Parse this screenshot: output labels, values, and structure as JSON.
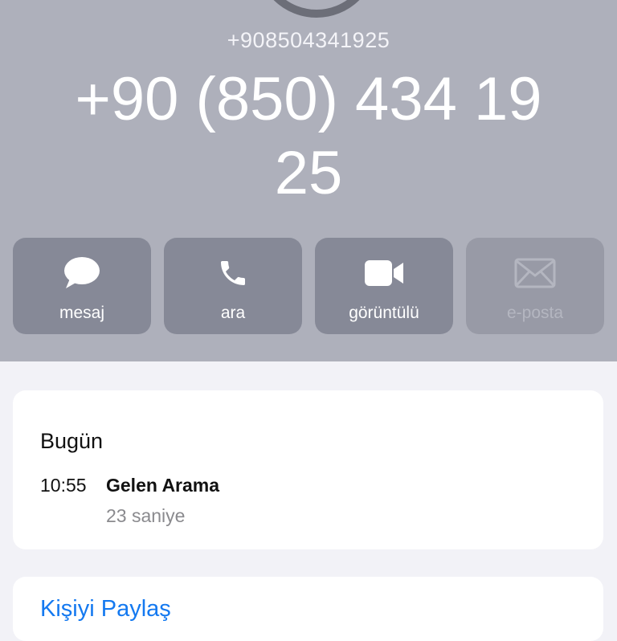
{
  "contact": {
    "phone_raw": "+908504341925",
    "display_name": "+90 (850) 434 19 25"
  },
  "actions": {
    "message_label": "mesaj",
    "call_label": "ara",
    "video_label": "görüntülü",
    "email_label": "e-posta"
  },
  "call_history": {
    "day": "Bugün",
    "time": "10:55",
    "type": "Gelen Arama",
    "duration": "23 saniye"
  },
  "share": {
    "label": "Kişiyi Paylaş"
  },
  "colors": {
    "header_bg": "#aeb0bb",
    "action_bg": "#868997",
    "link": "#1479f0"
  }
}
